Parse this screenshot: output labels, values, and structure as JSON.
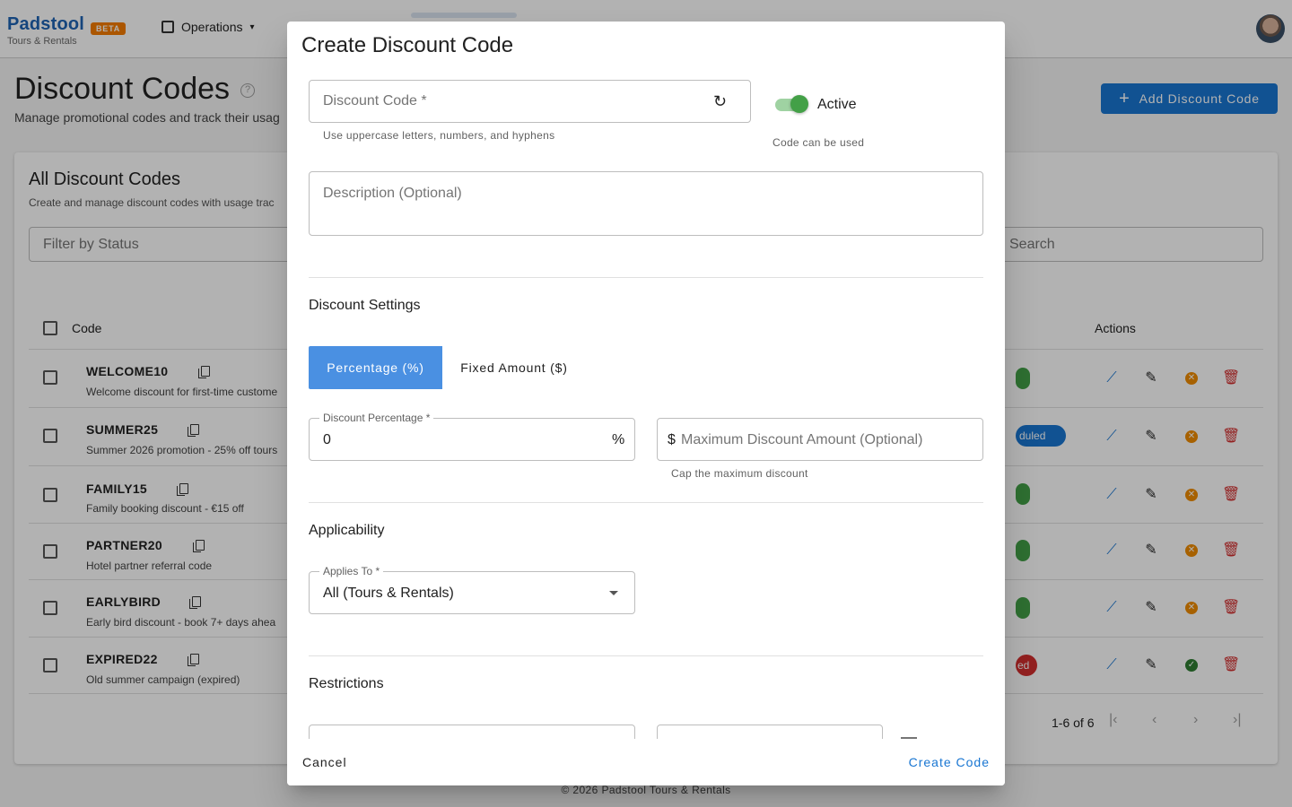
{
  "header": {
    "brand_name": "Padstool",
    "brand_subtitle": "Tours & Rentals",
    "beta_badge": "BETA",
    "nav_menu": "Operations"
  },
  "page": {
    "title": "Discount Codes",
    "subtitle": "Manage promotional codes and track their usag",
    "add_button": "Add Discount Code"
  },
  "card": {
    "title": "All Discount Codes",
    "subtitle": "Create and manage discount codes with usage trac",
    "filter_placeholder": "Filter by Status",
    "search_placeholder": "Search",
    "columns": {
      "code": "Code",
      "actions": "Actions"
    },
    "rows": [
      {
        "code": "WELCOME10",
        "description": "Welcome discount for first-time custome",
        "status": "",
        "status_color": "#43a047"
      },
      {
        "code": "SUMMER25",
        "description": "Summer 2026 promotion - 25% off tours",
        "status": "duled",
        "status_color": "#1976d2"
      },
      {
        "code": "FAMILY15",
        "description": "Family booking discount - €15 off",
        "status": "",
        "status_color": "#43a047"
      },
      {
        "code": "PARTNER20",
        "description": "Hotel partner referral code",
        "status": "",
        "status_color": "#43a047"
      },
      {
        "code": "EARLYBIRD",
        "description": "Early bird discount - book 7+ days ahea",
        "status": "",
        "status_color": "#43a047"
      },
      {
        "code": "EXPIRED22",
        "description": "Old summer campaign (expired)",
        "status": "ed",
        "status_color": "#d32f2f"
      }
    ],
    "pagination": "1-6 of 6"
  },
  "footer": "© 2026 Padstool Tours & Rentals",
  "dialog": {
    "title": "Create Discount Code",
    "code_field": {
      "placeholder": "Discount Code *",
      "helper": "Use uppercase letters, numbers, and hyphens"
    },
    "active_switch": {
      "label": "Active",
      "on": true,
      "helper": "Code can be used"
    },
    "description_field": {
      "placeholder": "Description (Optional)"
    },
    "discount_settings": {
      "heading": "Discount Settings",
      "type_options": [
        "Percentage (%)",
        "Fixed Amount ($)"
      ],
      "selected_type": "Percentage (%)",
      "percentage_field": {
        "label": "Discount Percentage *",
        "value": "0",
        "suffix": "%"
      },
      "max_field": {
        "prefix": "$",
        "placeholder": "Maximum Discount Amount (Optional)",
        "helper": "Cap the maximum discount"
      }
    },
    "applicability": {
      "heading": "Applicability",
      "applies_to": {
        "label": "Applies To *",
        "value": "All (Tours & Rentals)"
      }
    },
    "restrictions": {
      "heading": "Restrictions"
    },
    "actions": {
      "cancel": "Cancel",
      "create": "Create Code"
    }
  },
  "colors": {
    "primary": "#1976d2",
    "brand": "#1f63b4",
    "beta": "#f57c00",
    "active_green": "#43a047",
    "selected_toggle": "#4a90e2",
    "danger": "#d32f2f",
    "warning": "#ef8c00"
  }
}
